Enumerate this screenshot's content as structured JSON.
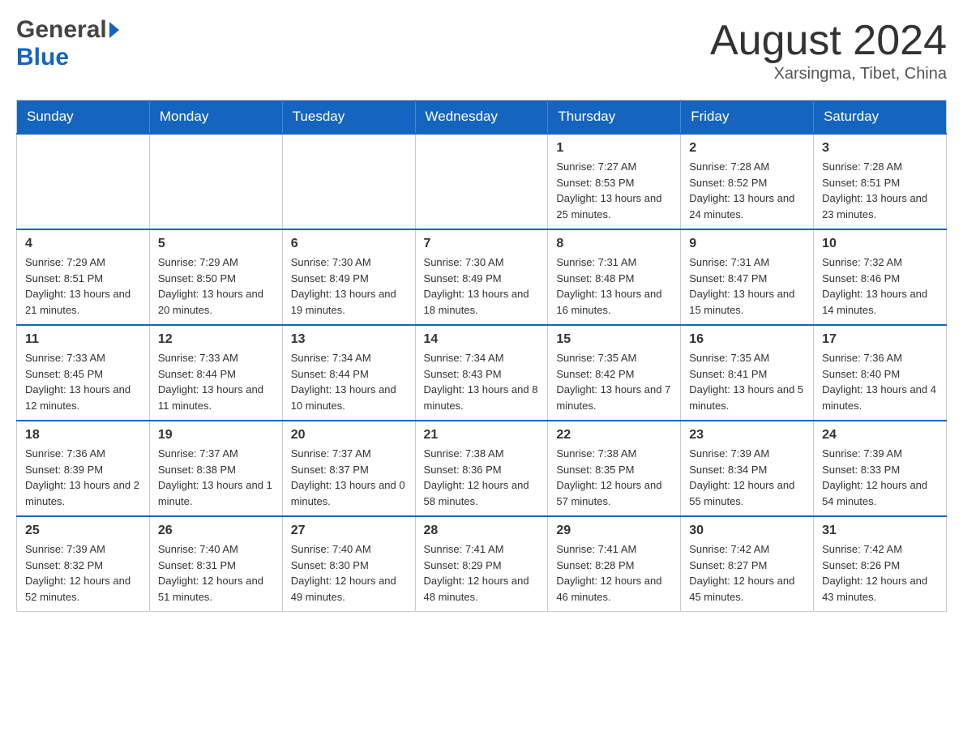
{
  "header": {
    "logo_general": "General",
    "logo_blue": "Blue",
    "month_title": "August 2024",
    "location": "Xarsingma, Tibet, China"
  },
  "days_of_week": [
    "Sunday",
    "Monday",
    "Tuesday",
    "Wednesday",
    "Thursday",
    "Friday",
    "Saturday"
  ],
  "weeks": [
    [
      {
        "day": "",
        "info": ""
      },
      {
        "day": "",
        "info": ""
      },
      {
        "day": "",
        "info": ""
      },
      {
        "day": "",
        "info": ""
      },
      {
        "day": "1",
        "info": "Sunrise: 7:27 AM\nSunset: 8:53 PM\nDaylight: 13 hours and 25 minutes."
      },
      {
        "day": "2",
        "info": "Sunrise: 7:28 AM\nSunset: 8:52 PM\nDaylight: 13 hours and 24 minutes."
      },
      {
        "day": "3",
        "info": "Sunrise: 7:28 AM\nSunset: 8:51 PM\nDaylight: 13 hours and 23 minutes."
      }
    ],
    [
      {
        "day": "4",
        "info": "Sunrise: 7:29 AM\nSunset: 8:51 PM\nDaylight: 13 hours and 21 minutes."
      },
      {
        "day": "5",
        "info": "Sunrise: 7:29 AM\nSunset: 8:50 PM\nDaylight: 13 hours and 20 minutes."
      },
      {
        "day": "6",
        "info": "Sunrise: 7:30 AM\nSunset: 8:49 PM\nDaylight: 13 hours and 19 minutes."
      },
      {
        "day": "7",
        "info": "Sunrise: 7:30 AM\nSunset: 8:49 PM\nDaylight: 13 hours and 18 minutes."
      },
      {
        "day": "8",
        "info": "Sunrise: 7:31 AM\nSunset: 8:48 PM\nDaylight: 13 hours and 16 minutes."
      },
      {
        "day": "9",
        "info": "Sunrise: 7:31 AM\nSunset: 8:47 PM\nDaylight: 13 hours and 15 minutes."
      },
      {
        "day": "10",
        "info": "Sunrise: 7:32 AM\nSunset: 8:46 PM\nDaylight: 13 hours and 14 minutes."
      }
    ],
    [
      {
        "day": "11",
        "info": "Sunrise: 7:33 AM\nSunset: 8:45 PM\nDaylight: 13 hours and 12 minutes."
      },
      {
        "day": "12",
        "info": "Sunrise: 7:33 AM\nSunset: 8:44 PM\nDaylight: 13 hours and 11 minutes."
      },
      {
        "day": "13",
        "info": "Sunrise: 7:34 AM\nSunset: 8:44 PM\nDaylight: 13 hours and 10 minutes."
      },
      {
        "day": "14",
        "info": "Sunrise: 7:34 AM\nSunset: 8:43 PM\nDaylight: 13 hours and 8 minutes."
      },
      {
        "day": "15",
        "info": "Sunrise: 7:35 AM\nSunset: 8:42 PM\nDaylight: 13 hours and 7 minutes."
      },
      {
        "day": "16",
        "info": "Sunrise: 7:35 AM\nSunset: 8:41 PM\nDaylight: 13 hours and 5 minutes."
      },
      {
        "day": "17",
        "info": "Sunrise: 7:36 AM\nSunset: 8:40 PM\nDaylight: 13 hours and 4 minutes."
      }
    ],
    [
      {
        "day": "18",
        "info": "Sunrise: 7:36 AM\nSunset: 8:39 PM\nDaylight: 13 hours and 2 minutes."
      },
      {
        "day": "19",
        "info": "Sunrise: 7:37 AM\nSunset: 8:38 PM\nDaylight: 13 hours and 1 minute."
      },
      {
        "day": "20",
        "info": "Sunrise: 7:37 AM\nSunset: 8:37 PM\nDaylight: 13 hours and 0 minutes."
      },
      {
        "day": "21",
        "info": "Sunrise: 7:38 AM\nSunset: 8:36 PM\nDaylight: 12 hours and 58 minutes."
      },
      {
        "day": "22",
        "info": "Sunrise: 7:38 AM\nSunset: 8:35 PM\nDaylight: 12 hours and 57 minutes."
      },
      {
        "day": "23",
        "info": "Sunrise: 7:39 AM\nSunset: 8:34 PM\nDaylight: 12 hours and 55 minutes."
      },
      {
        "day": "24",
        "info": "Sunrise: 7:39 AM\nSunset: 8:33 PM\nDaylight: 12 hours and 54 minutes."
      }
    ],
    [
      {
        "day": "25",
        "info": "Sunrise: 7:39 AM\nSunset: 8:32 PM\nDaylight: 12 hours and 52 minutes."
      },
      {
        "day": "26",
        "info": "Sunrise: 7:40 AM\nSunset: 8:31 PM\nDaylight: 12 hours and 51 minutes."
      },
      {
        "day": "27",
        "info": "Sunrise: 7:40 AM\nSunset: 8:30 PM\nDaylight: 12 hours and 49 minutes."
      },
      {
        "day": "28",
        "info": "Sunrise: 7:41 AM\nSunset: 8:29 PM\nDaylight: 12 hours and 48 minutes."
      },
      {
        "day": "29",
        "info": "Sunrise: 7:41 AM\nSunset: 8:28 PM\nDaylight: 12 hours and 46 minutes."
      },
      {
        "day": "30",
        "info": "Sunrise: 7:42 AM\nSunset: 8:27 PM\nDaylight: 12 hours and 45 minutes."
      },
      {
        "day": "31",
        "info": "Sunrise: 7:42 AM\nSunset: 8:26 PM\nDaylight: 12 hours and 43 minutes."
      }
    ]
  ]
}
